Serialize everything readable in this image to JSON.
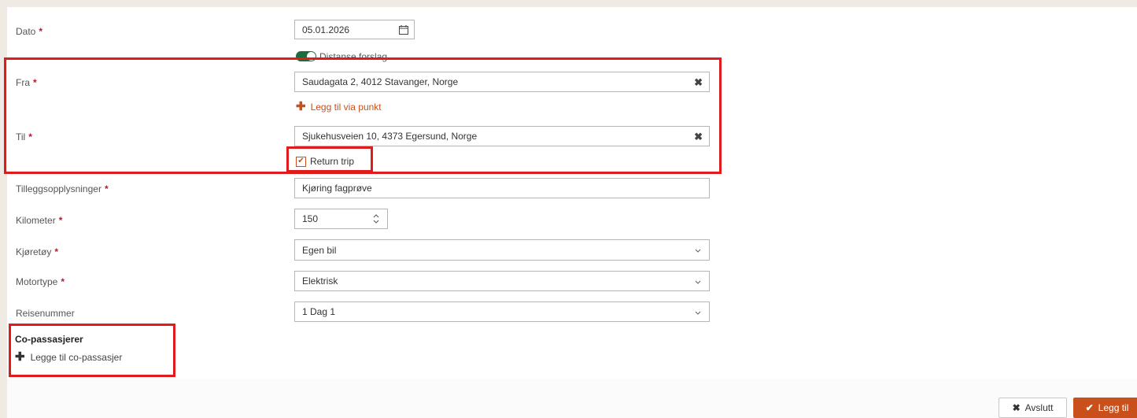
{
  "form": {
    "dato": {
      "label": "Dato",
      "value": "05.01.2026"
    },
    "toggle_label": "Distanse forslag",
    "fra": {
      "label": "Fra",
      "value": "Saudagata 2, 4012 Stavanger, Norge"
    },
    "via_link": "Legg til via punkt",
    "til": {
      "label": "Til",
      "value": "Sjukehusveien 10, 4373 Egersund, Norge"
    },
    "return_trip": {
      "label": "Return trip",
      "checked": true
    },
    "tillegg": {
      "label": "Tilleggsopplysninger",
      "value": "Kjøring fagprøve"
    },
    "kilometer": {
      "label": "Kilometer",
      "value": "150"
    },
    "kjoretoy": {
      "label": "Kjøretøy",
      "value": "Egen bil"
    },
    "motortype": {
      "label": "Motortype",
      "value": "Elektrisk"
    },
    "reisenummer": {
      "label": "Reisenummer",
      "value": "1 Dag 1"
    },
    "required_mark": "*"
  },
  "co_passengers": {
    "title": "Co-passasjerer",
    "add_label": "Legge til co-passasjer"
  },
  "footer": {
    "cancel_label": "Avslutt",
    "add_label": "Legg til"
  },
  "colors": {
    "accent": "#c9501a",
    "highlight": "#e01b1b",
    "toggle": "#1e6b3d",
    "required": "#c8102e"
  }
}
